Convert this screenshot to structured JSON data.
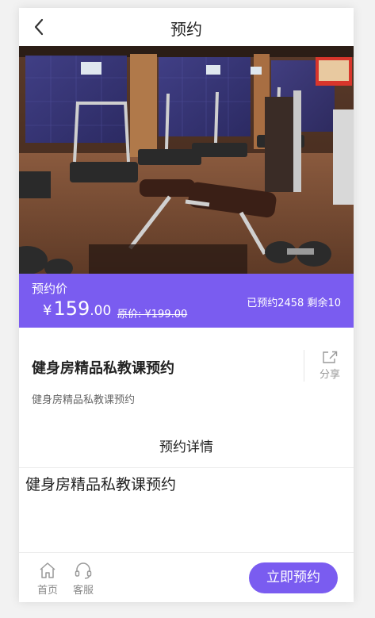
{
  "header": {
    "title": "预约"
  },
  "hero": {
    "alt": "gym photo"
  },
  "price_bar": {
    "tag": "预约价",
    "currency": "¥",
    "price_integer": "159",
    "price_decimal": ".00",
    "original_price": "原价: ¥199.00",
    "stats": "已预约2458 剩余10",
    "accent_color": "#7a5cf0"
  },
  "product": {
    "name": "健身房精品私教课预约",
    "description": "健身房精品私教课预约",
    "share_label": "分享"
  },
  "detail": {
    "section_title": "预约详情",
    "content": "健身房精品私教课预约"
  },
  "bottom_bar": {
    "home_label": "首页",
    "service_label": "客服",
    "book_button": "立即预约"
  }
}
